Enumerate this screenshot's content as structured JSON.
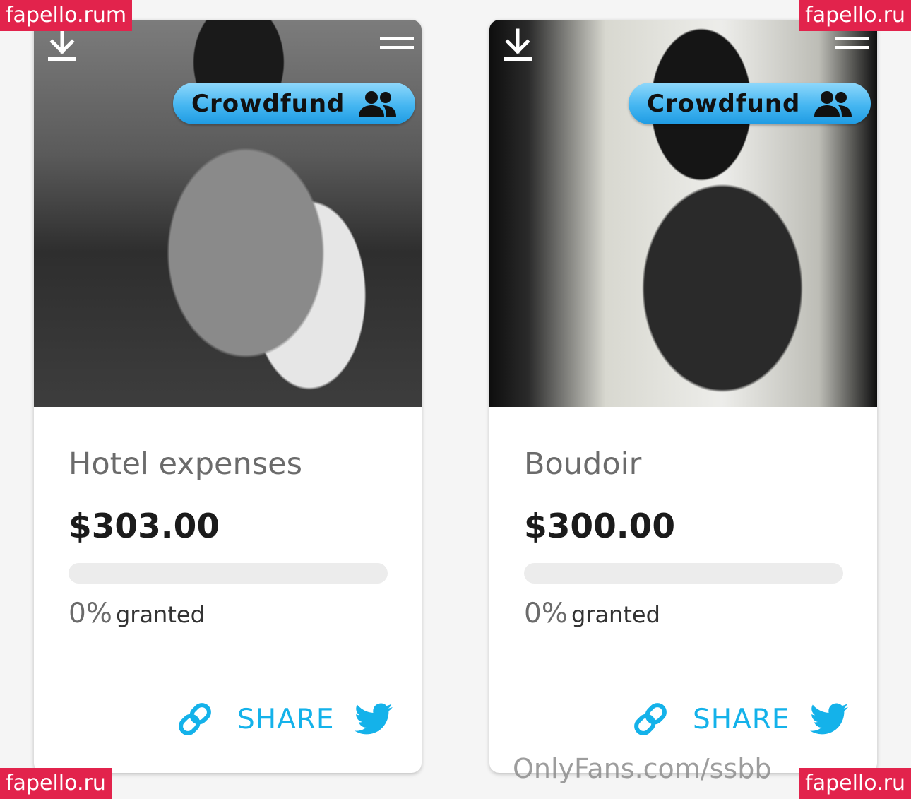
{
  "cards": [
    {
      "badge_label": "Crowdfund",
      "title": "Hotel expenses",
      "amount": "$303.00",
      "progress_percent": 0,
      "percent_text": "0%",
      "granted_text": "granted",
      "share_label": "SHARE"
    },
    {
      "badge_label": "Crowdfund",
      "title": "Boudoir",
      "amount": "$300.00",
      "progress_percent": 0,
      "percent_text": "0%",
      "granted_text": "granted",
      "share_label": "SHARE"
    }
  ],
  "watermarks": {
    "top_left": "fapello.rum",
    "top_right": "fapello.ru",
    "bottom_left": "fapello.ru",
    "bottom_right": "fapello.ru"
  },
  "onlyfans_mark": "OnlyFans.com/ssbb",
  "colors": {
    "accent": "#14b2ea",
    "badge": "#45b6f1",
    "watermark": "#e2234c"
  }
}
